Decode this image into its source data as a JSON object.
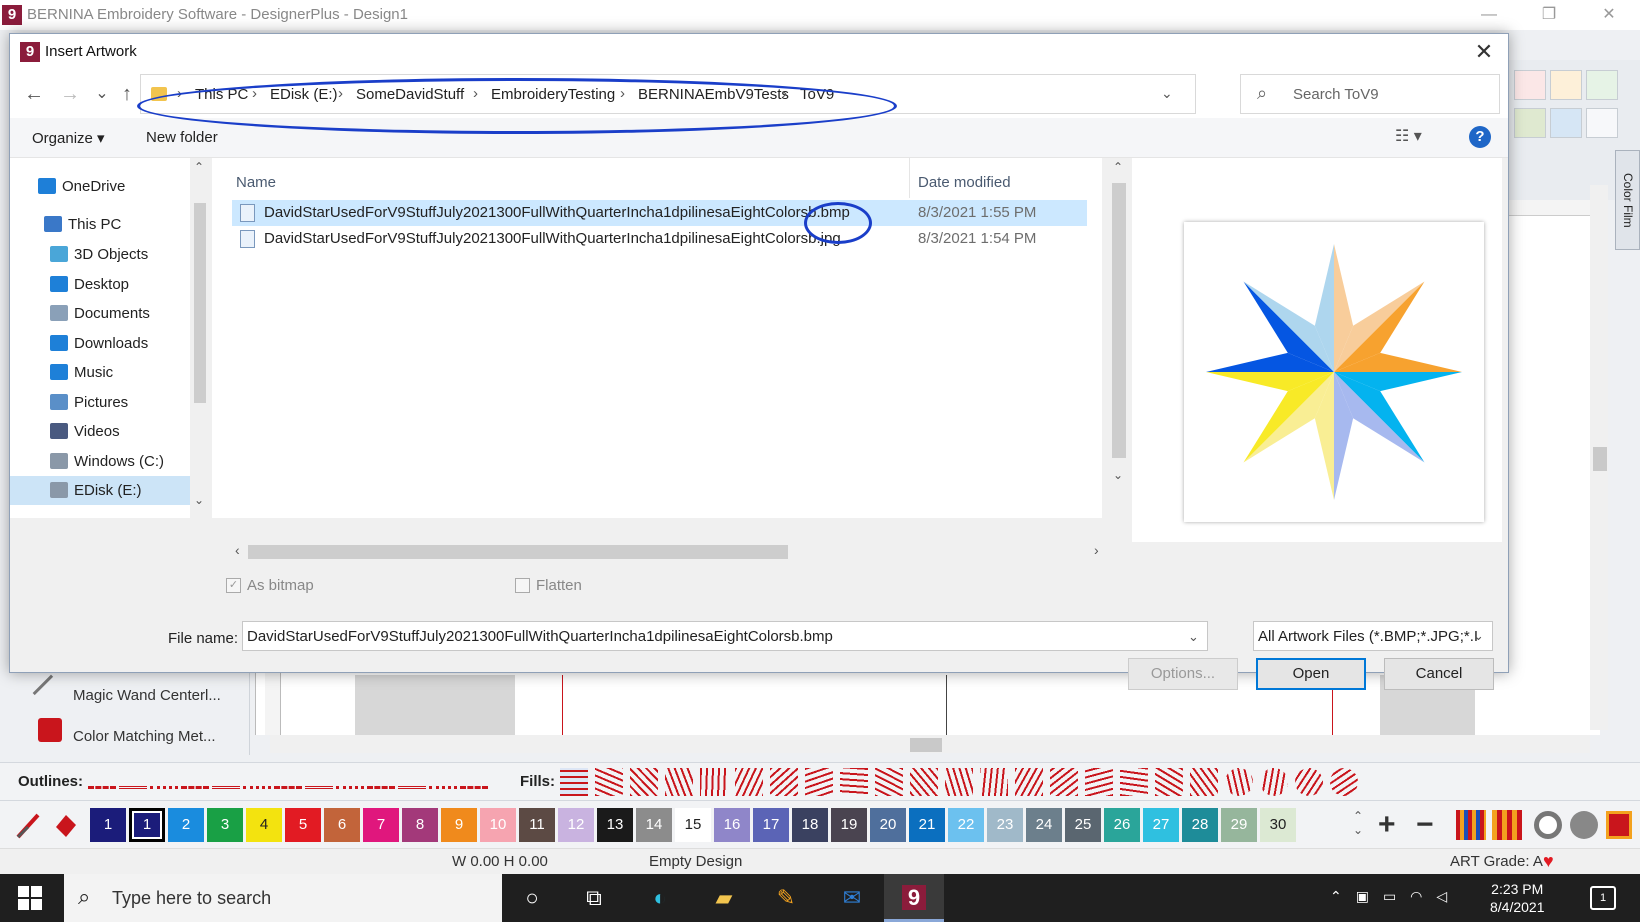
{
  "app": {
    "logo": "9",
    "title": "BERNINA Embroidery Software - DesignerPlus - Design1",
    "minimize": "—",
    "restore": "❐",
    "close": "✕",
    "color_film_tab": "Color Film"
  },
  "dialog": {
    "icon": "9",
    "title": "Insert Artwork",
    "close": "✕",
    "nav": {
      "back": "←",
      "forward": "→",
      "recent": "⌄",
      "up": "↑"
    },
    "breadcrumbs": [
      "This PC",
      "EDisk (E:)",
      "SomeDavidStuff",
      "EmbroideryTesting",
      "BERNINAEmbV9Tests",
      "ToV9"
    ],
    "search_placeholder": "Search ToV9",
    "toolbar": {
      "organize": "Organize ▾",
      "new_folder": "New folder",
      "help": "?"
    },
    "nav_pane": [
      {
        "label": "OneDrive",
        "icon": "cloud-icon",
        "color": "#1e7fd8"
      },
      {
        "label": "This PC",
        "icon": "computer-icon",
        "color": "#3a78c8"
      },
      {
        "label": "3D Objects",
        "icon": "cube-icon",
        "color": "#4aa6d8"
      },
      {
        "label": "Desktop",
        "icon": "desktop-icon",
        "color": "#1e80d8"
      },
      {
        "label": "Documents",
        "icon": "document-icon",
        "color": "#8aa0b8"
      },
      {
        "label": "Downloads",
        "icon": "download-icon",
        "color": "#1e80d8"
      },
      {
        "label": "Music",
        "icon": "music-icon",
        "color": "#1e80d8"
      },
      {
        "label": "Pictures",
        "icon": "pictures-icon",
        "color": "#5a8fc8"
      },
      {
        "label": "Videos",
        "icon": "videos-icon",
        "color": "#4a5a80"
      },
      {
        "label": "Windows (C:)",
        "icon": "drive-icon",
        "color": "#8a98a8"
      },
      {
        "label": "EDisk (E:)",
        "icon": "drive-icon",
        "color": "#8a98a8"
      }
    ],
    "columns": {
      "name": "Name",
      "date": "Date modified"
    },
    "files": [
      {
        "name": "DavidStarUsedForV9StuffJuly2021300FullWithQuarterIncha1dpilinesaEightColorsb.bmp",
        "date": "8/3/2021 1:55 PM"
      },
      {
        "name": "DavidStarUsedForV9StuffJuly2021300FullWithQuarterIncha1dpilinesaEightColorsb.jpg",
        "date": "8/3/2021 1:54 PM"
      }
    ],
    "as_bitmap": "As bitmap",
    "flatten": "Flatten",
    "file_name_label": "File name:",
    "file_name_value": "DavidStarUsedForV9StuffJuly2021300FullWithQuarterIncha1dpilinesaEightColorsb.bmp",
    "file_type": "All Artwork Files (*.BMP;*.JPG;*.I",
    "buttons": {
      "options": "Options...",
      "open": "Open",
      "cancel": "Cancel"
    },
    "preview_colors": [
      "#aed6ee",
      "#f8cd9b",
      "#f7a22f",
      "#04b3ef",
      "#a7b9ef",
      "#f9ee94",
      "#f8ea27",
      "#0556e2"
    ]
  },
  "left_panel": {
    "items": [
      "Magic Wand Centerl...",
      "Color Matching Met..."
    ]
  },
  "stitch_bar": {
    "outlines": "Outlines:",
    "fills": "Fills:"
  },
  "palette": {
    "swatches": [
      {
        "n": "1",
        "color": "#1b1c7a"
      },
      {
        "n": "1",
        "color": "#1b1c7a"
      },
      {
        "n": "2",
        "color": "#1a8cde"
      },
      {
        "n": "3",
        "color": "#19a045"
      },
      {
        "n": "4",
        "color": "#f3e30f"
      },
      {
        "n": "5",
        "color": "#e21b23"
      },
      {
        "n": "6",
        "color": "#c2643a"
      },
      {
        "n": "7",
        "color": "#e0177d"
      },
      {
        "n": "8",
        "color": "#a3397a"
      },
      {
        "n": "9",
        "color": "#f08a1c"
      },
      {
        "n": "10",
        "color": "#f6a4b0"
      },
      {
        "n": "11",
        "color": "#5c4a44"
      },
      {
        "n": "12",
        "color": "#c9b3e0"
      },
      {
        "n": "13",
        "color": "#1a1a1a"
      },
      {
        "n": "14",
        "color": "#8c8c8c"
      },
      {
        "n": "15",
        "color": "#ffffff"
      },
      {
        "n": "16",
        "color": "#8f86c9"
      },
      {
        "n": "17",
        "color": "#5b64b6"
      },
      {
        "n": "18",
        "color": "#3a4160"
      },
      {
        "n": "19",
        "color": "#4a4450"
      },
      {
        "n": "20",
        "color": "#4f6f9c"
      },
      {
        "n": "21",
        "color": "#0b6fbf"
      },
      {
        "n": "22",
        "color": "#6cc1ef"
      },
      {
        "n": "23",
        "color": "#a0b9c9"
      },
      {
        "n": "24",
        "color": "#6c7f8c"
      },
      {
        "n": "25",
        "color": "#5a6670"
      },
      {
        "n": "26",
        "color": "#2aa59a"
      },
      {
        "n": "27",
        "color": "#2fc0e0"
      },
      {
        "n": "28",
        "color": "#1e8c99"
      },
      {
        "n": "29",
        "color": "#96b69c"
      },
      {
        "n": "30",
        "color": "#dce9d3"
      }
    ]
  },
  "status": {
    "size": "W 0.00 H 0.00",
    "design": "Empty Design",
    "art_grade": "ART Grade: A",
    "heart": "♥"
  },
  "taskbar": {
    "search_placeholder": "Type here to search",
    "time": "2:23 PM",
    "date": "8/4/2021",
    "notifications": "1",
    "bernina_app": "9"
  }
}
